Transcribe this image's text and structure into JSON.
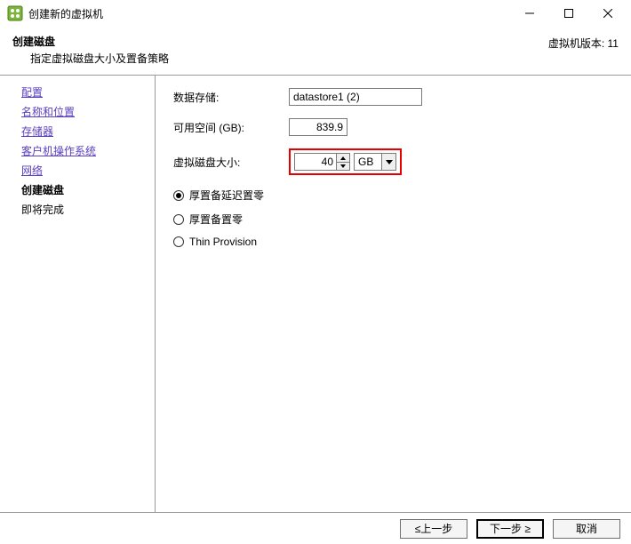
{
  "window": {
    "title": "创建新的虚拟机"
  },
  "header": {
    "title": "创建磁盘",
    "subtitle": "指定虚拟磁盘大小及置备策略",
    "version": "虚拟机版本: 11"
  },
  "sidebar": {
    "items": [
      {
        "label": "配置",
        "state": "link"
      },
      {
        "label": "名称和位置",
        "state": "link"
      },
      {
        "label": "存储器",
        "state": "link"
      },
      {
        "label": "客户机操作系统",
        "state": "link"
      },
      {
        "label": "网络",
        "state": "link"
      },
      {
        "label": "创建磁盘",
        "state": "active"
      },
      {
        "label": "即将完成",
        "state": "pending"
      }
    ]
  },
  "form": {
    "datastore_label": "数据存储:",
    "datastore_value": "datastore1 (2)",
    "avail_label": "可用空间 (GB):",
    "avail_value": "839.9",
    "disksize_label": "虚拟磁盘大小:",
    "disksize_value": "40",
    "disksize_unit": "GB",
    "provision_options": [
      {
        "label": "厚置备延迟置零",
        "checked": true
      },
      {
        "label": "厚置备置零",
        "checked": false
      },
      {
        "label": "Thin Provision",
        "checked": false
      }
    ]
  },
  "footer": {
    "back": "≤上一步",
    "next": "下一步 ≥",
    "cancel": "取消"
  }
}
